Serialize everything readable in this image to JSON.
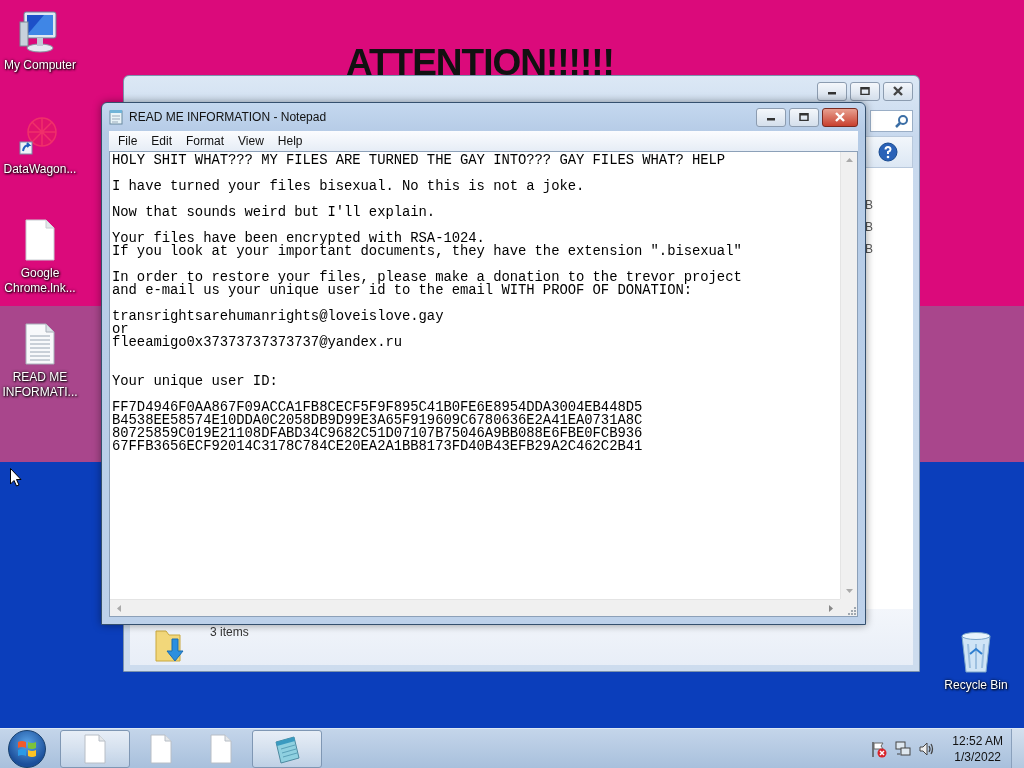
{
  "wallpaper": {
    "headline": "ATTENTION!!!!!!"
  },
  "desktop_icons": [
    {
      "label": "My Computer",
      "kind": "computer"
    },
    {
      "label": "DataWagon...",
      "kind": "shortcut"
    },
    {
      "label": "Google Chrome.lnk...",
      "kind": "file"
    },
    {
      "label": "READ ME INFORMATI...",
      "kind": "notes"
    },
    {
      "label": "Recycle Bin",
      "kind": "recycle"
    }
  ],
  "explorer": {
    "size_fragments": [
      "B",
      "B",
      "B"
    ],
    "status": "3 items"
  },
  "notepad": {
    "title": "READ ME INFORMATION - Notepad",
    "menu": [
      "File",
      "Edit",
      "Format",
      "View",
      "Help"
    ],
    "text": "HOLY SHIT WHAT??? MY FILES ARE TURNED THE GAY INTO??? GAY FILES WHAT? HELP\n\nI have turned your files bisexual. No this is not a joke.\n\nNow that sounds weird but I'll explain.\n\nYour files have been encrypted with RSA-1024.\nIf you look at your important documents, they have the extension \".bisexual\"\n\nIn order to restore your files, please make a donation to the trevor project\nand e-mail us your unique user id to the email WITH PROOF OF DONATION:\n\ntransrightsarehumanrights@loveislove.gay\nor\nfleeamigo0x37373737373737@yandex.ru\n\n\nYour unique user ID:\n\nFF7D4946F0AA867F09ACCA1FB8CECF5F9F895C41B0FE6E8954DDA3004EB448D5\nB4538EE58574E10DDA0C2058DB9D99E3A65F919609C6780636E2A41EA0731A8C\n80725859C019E21108DFABD34C9682C51D07107B75046A9BB088E6FBE0FCB936\n67FFB3656ECF92014C3178C784CE20EA2A1BB8173FD40B43EFB29A2C462C2B41"
  },
  "taskbar": {
    "buttons": [
      {
        "kind": "file",
        "open": true
      },
      {
        "kind": "file",
        "open": false
      },
      {
        "kind": "file",
        "open": false
      },
      {
        "kind": "notepad",
        "open": true
      }
    ],
    "time": "12:52 AM",
    "date": "1/3/2022"
  }
}
